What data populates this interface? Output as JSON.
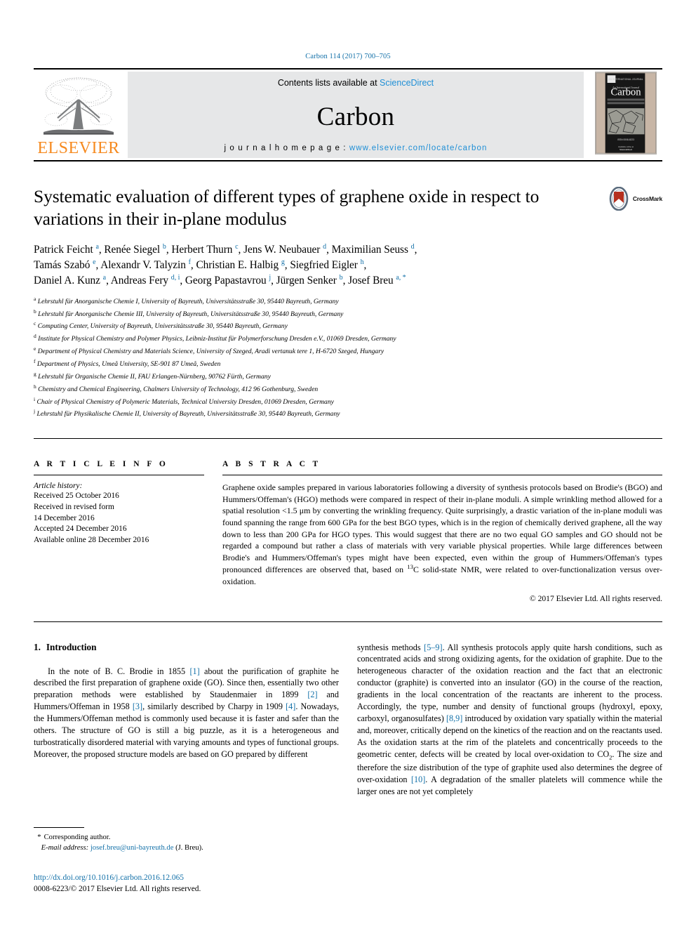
{
  "running_head": "Carbon 114 (2017) 700–705",
  "masthead": {
    "contents_prefix": "Contents lists available at ",
    "contents_link": "ScienceDirect",
    "journal_name": "Carbon",
    "homepage_prefix": "j o u r n a l   h o m e p a g e :   ",
    "homepage_url": "www.elsevier.com/locate/carbon",
    "publisher_wordmark": "ELSEVIER",
    "cover_alt": "Carbon journal cover"
  },
  "article": {
    "title": "Systematic evaluation of different types of graphene oxide in respect to variations in their in-plane modulus",
    "crossmark_label": "CrossMark",
    "authors_lines": [
      "Patrick Feicht a, Renée Siegel b, Herbert Thurn c, Jens W. Neubauer d, Maximilian Seuss d,",
      "Tamás Szabó e, Alexandr V. Talyzin f, Christian E. Halbig g, Siegfried Eigler h,",
      "Daniel A. Kunz a, Andreas Fery d, i, Georg Papastavrou j, Jürgen Senker b, Josef Breu a, *"
    ],
    "affiliations": [
      {
        "mark": "a",
        "text": "Lehrstuhl für Anorganische Chemie I, University of Bayreuth, Universitätsstraße 30, 95440 Bayreuth, Germany"
      },
      {
        "mark": "b",
        "text": "Lehrstuhl für Anorganische Chemie III, University of Bayreuth, Universitätsstraße 30, 95440 Bayreuth, Germany"
      },
      {
        "mark": "c",
        "text": "Computing Center, University of Bayreuth, Universitätsstraße 30, 95440 Bayreuth, Germany"
      },
      {
        "mark": "d",
        "text": "Institute for Physical Chemistry and Polymer Physics, Leibniz-Institut für Polymerforschung Dresden e.V., 01069 Dresden, Germany"
      },
      {
        "mark": "e",
        "text": "Department of Physical Chemistry and Materials Science, University of Szeged, Aradi vertanuk tere 1, H-6720 Szeged, Hungary"
      },
      {
        "mark": "f",
        "text": "Department of Physics, Umeå University, SE-901 87 Umeå, Sweden"
      },
      {
        "mark": "g",
        "text": "Lehrstuhl für Organische Chemie II, FAU Erlangen-Nürnberg, 90762 Fürth, Germany"
      },
      {
        "mark": "h",
        "text": "Chemistry and Chemical Engineering, Chalmers University of Technology, 412 96 Gothenburg, Sweden"
      },
      {
        "mark": "i",
        "text": "Chair of Physical Chemistry of Polymeric Materials, Technical University Dresden, 01069 Dresden, Germany"
      },
      {
        "mark": "j",
        "text": "Lehrstuhl für Physikalische Chemie II, University of Bayreuth, Universitätsstraße 30, 95440 Bayreuth, Germany"
      }
    ]
  },
  "article_info": {
    "heading": "A R T I C L E   I N F O",
    "history_label": "Article history:",
    "history": [
      "Received 25 October 2016",
      "Received in revised form",
      "14 December 2016",
      "Accepted 24 December 2016",
      "Available online 28 December 2016"
    ]
  },
  "abstract": {
    "heading": "A B S T R A C T",
    "text_part1": "Graphene oxide samples prepared in various laboratories following a diversity of synthesis protocols based on Brodie's (BGO) and Hummers/Offeman's (HGO) methods were compared in respect of their in-plane moduli. A simple wrinkling method allowed for a spatial resolution <1.5 μm by converting the wrinkling frequency. Quite surprisingly, a drastic variation of the in-plane moduli was found spanning the range from 600 GPa for the best BGO types, which is in the region of chemically derived graphene, all the way down to less than 200 GPa for HGO types. This would suggest that there are no two equal GO samples and GO should not be regarded a compound but rather a class of materials with very variable physical properties. While large differences between Brodie's and Hummers/Offeman's types might have been expected, even within the group of Hummers/Offeman's types pronounced differences are observed that, based on ",
    "superscript": "13",
    "text_part2": "C solid-state NMR, were related to over-functionalization versus over-oxidation.",
    "copyright": "© 2017 Elsevier Ltd. All rights reserved."
  },
  "introduction": {
    "number": "1.",
    "heading": "Introduction",
    "left_col": {
      "p1_a": "In the note of B. C. Brodie in 1855 ",
      "r1": "[1]",
      "p1_b": " about the purification of graphite he described the first preparation of graphene oxide (GO). Since then, essentially two other preparation methods were established by Staudenmaier in 1899 ",
      "r2": "[2]",
      "p1_c": " and Hummers/Offeman in 1958 ",
      "r3": "[3]",
      "p1_d": ", similarly described by Charpy in 1909 ",
      "r4": "[4]",
      "p1_e": ". Nowadays, the Hummers/Offeman method is commonly used because it is faster and safer than the others. The structure of GO is still a big puzzle, as it is a heterogeneous and turbostratically disordered material with varying amounts and types of functional groups. Moreover, the proposed structure models are based on GO prepared by different"
    },
    "right_col": {
      "p_a": "synthesis methods ",
      "r59": "[5–9]",
      "p_b": ". All synthesis protocols apply quite harsh conditions, such as concentrated acids and strong oxidizing agents, for the oxidation of graphite. Due to the heterogeneous character of the oxidation reaction and the fact that an electronic conductor (graphite) is converted into an insulator (GO) in the course of the reaction, gradients in the local concentration of the reactants are inherent to the process. Accordingly, the type, number and density of functional groups (hydroxyl, epoxy, carboxyl, organosulfates) ",
      "r89": "[8,9]",
      "p_c": " introduced by oxidation vary spatially within the material and, moreover, critically depend on the kinetics of the reaction and on the reactants used. As the oxidation starts at the rim of the platelets and concentrically proceeds to the geometric center, defects will be created by local over-oxidation to CO",
      "sub2": "2",
      "p_d": ". The size and therefore the size distribution of the type of graphite used also determines the degree of over-oxidation ",
      "r10": "[10]",
      "p_e": ". A degradation of the smaller platelets will commence while the larger ones are not yet completely"
    }
  },
  "footer": {
    "corresponding_star": "*",
    "corresponding_label": "Corresponding author.",
    "email_label": "E-mail address:",
    "email": "josef.breu@uni-bayreuth.de",
    "email_suffix": "(J. Breu).",
    "doi": "http://dx.doi.org/10.1016/j.carbon.2016.12.065",
    "issn_line": "0008-6223/© 2017 Elsevier Ltd. All rights reserved."
  },
  "colors": {
    "link_blue": "#1270a8",
    "sciencedirect_blue": "#1f8fd6",
    "elsevier_orange": "#f68a1f",
    "masthead_gray": "#e6e7e8",
    "crossmark_red": "#b5301f"
  }
}
